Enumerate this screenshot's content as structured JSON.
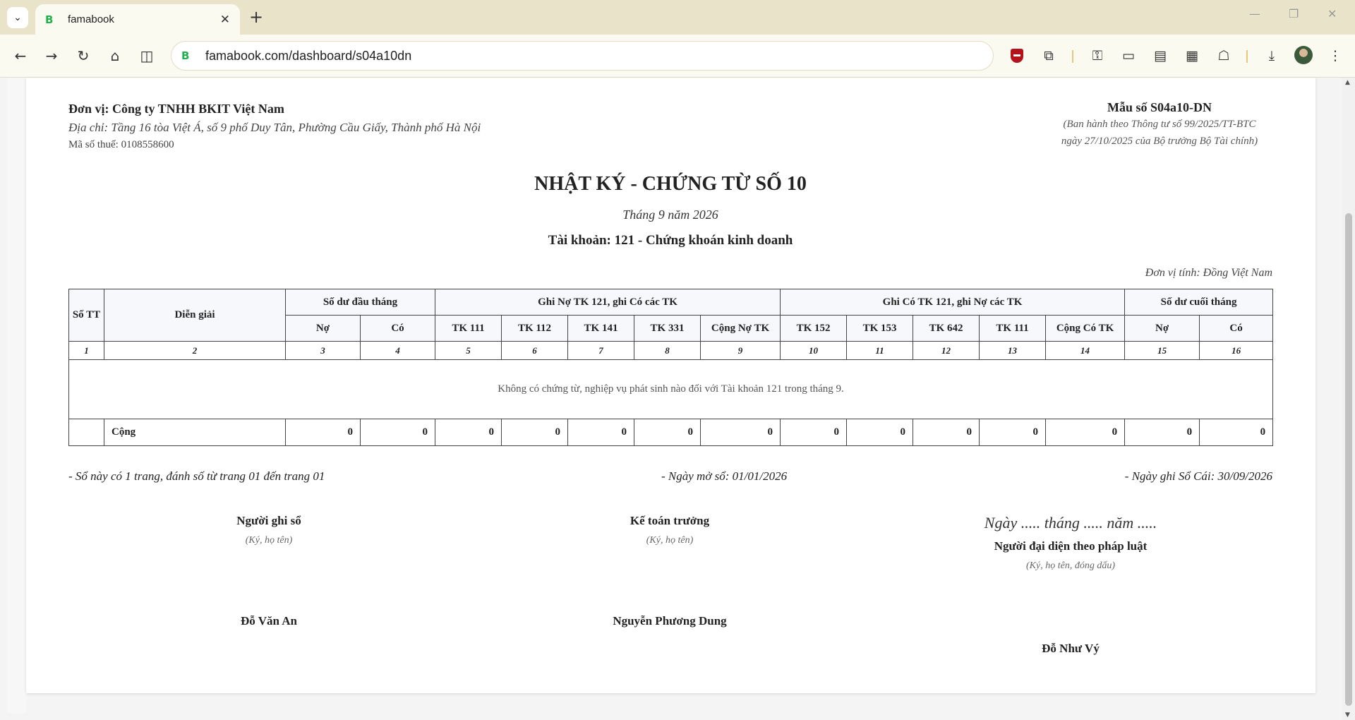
{
  "browser": {
    "tab_title": "famabook",
    "tab_favicon": "B",
    "url": "famabook.com/dashboard/s04a10dn"
  },
  "header": {
    "company": "Đơn vị: Công ty TNHH BKIT Việt Nam",
    "address": "Địa chỉ: Tầng 16 tòa Việt Á, số 9 phố Duy Tân, Phường Cầu Giấy, Thành phố Hà Nội",
    "tax_code": "Mã số thuế: 0108558600",
    "form_no": "Mẫu số S04a10-DN",
    "form_note_1": "(Ban hành theo Thông tư số 99/2025/TT-BTC",
    "form_note_2": "ngày 27/10/2025 của Bộ trưởng Bộ Tài chính)"
  },
  "title": "NHẬT KÝ - CHỨNG TỪ SỐ 10",
  "period": "Tháng 9 năm 2026",
  "account": "Tài khoản: 121 - Chứng khoán kinh doanh",
  "unit": "Đơn vị tính: Đồng Việt Nam",
  "table": {
    "h_stt": "Số TT",
    "h_desc": "Diễn giải",
    "h_opening": "Số dư đầu tháng",
    "h_debit_group": "Ghi Nợ TK 121, ghi Có các TK",
    "h_credit_group": "Ghi Có TK 121, ghi Nợ các TK",
    "h_closing": "Số dư cuối tháng",
    "h_no": "Nợ",
    "h_co": "Có",
    "debit_cols": [
      "TK 111",
      "TK 112",
      "TK 141",
      "TK 331",
      "Cộng Nợ TK"
    ],
    "credit_cols": [
      "TK 152",
      "TK 153",
      "TK 642",
      "TK 111",
      "Cộng Có TK"
    ],
    "index_row": [
      "1",
      "2",
      "3",
      "4",
      "5",
      "6",
      "7",
      "8",
      "9",
      "10",
      "11",
      "12",
      "13",
      "14",
      "15",
      "16"
    ],
    "empty_message": "Không có chứng từ, nghiệp vụ phát sinh nào đối với Tài khoản 121 trong tháng 9.",
    "total_label": "Cộng",
    "totals": [
      "0",
      "0",
      "0",
      "0",
      "0",
      "0",
      "0",
      "0",
      "0",
      "0",
      "0",
      "0",
      "0",
      "0"
    ]
  },
  "footer": {
    "pages_note": "- Sổ này có 1 trang, đánh số từ trang 01 đến trang 01",
    "open_date": "- Ngày mở sổ: 01/01/2026",
    "ledger_date": "- Ngày ghi Sổ Cái: 30/09/2026"
  },
  "signatures": {
    "preparer_role": "Người ghi sổ",
    "preparer_hint": "(Ký, họ tên)",
    "preparer_name": "Đỗ Văn An",
    "accountant_role": "Kế toán trưởng",
    "accountant_hint": "(Ký, họ tên)",
    "accountant_name": "Nguyễn Phương Dung",
    "date_line": "Ngày ..... tháng ..... năm .....",
    "legal_role": "Người đại diện theo pháp luật",
    "legal_hint": "(Ký, họ tên, đóng dấu)",
    "legal_name": "Đỗ Như Vý"
  }
}
